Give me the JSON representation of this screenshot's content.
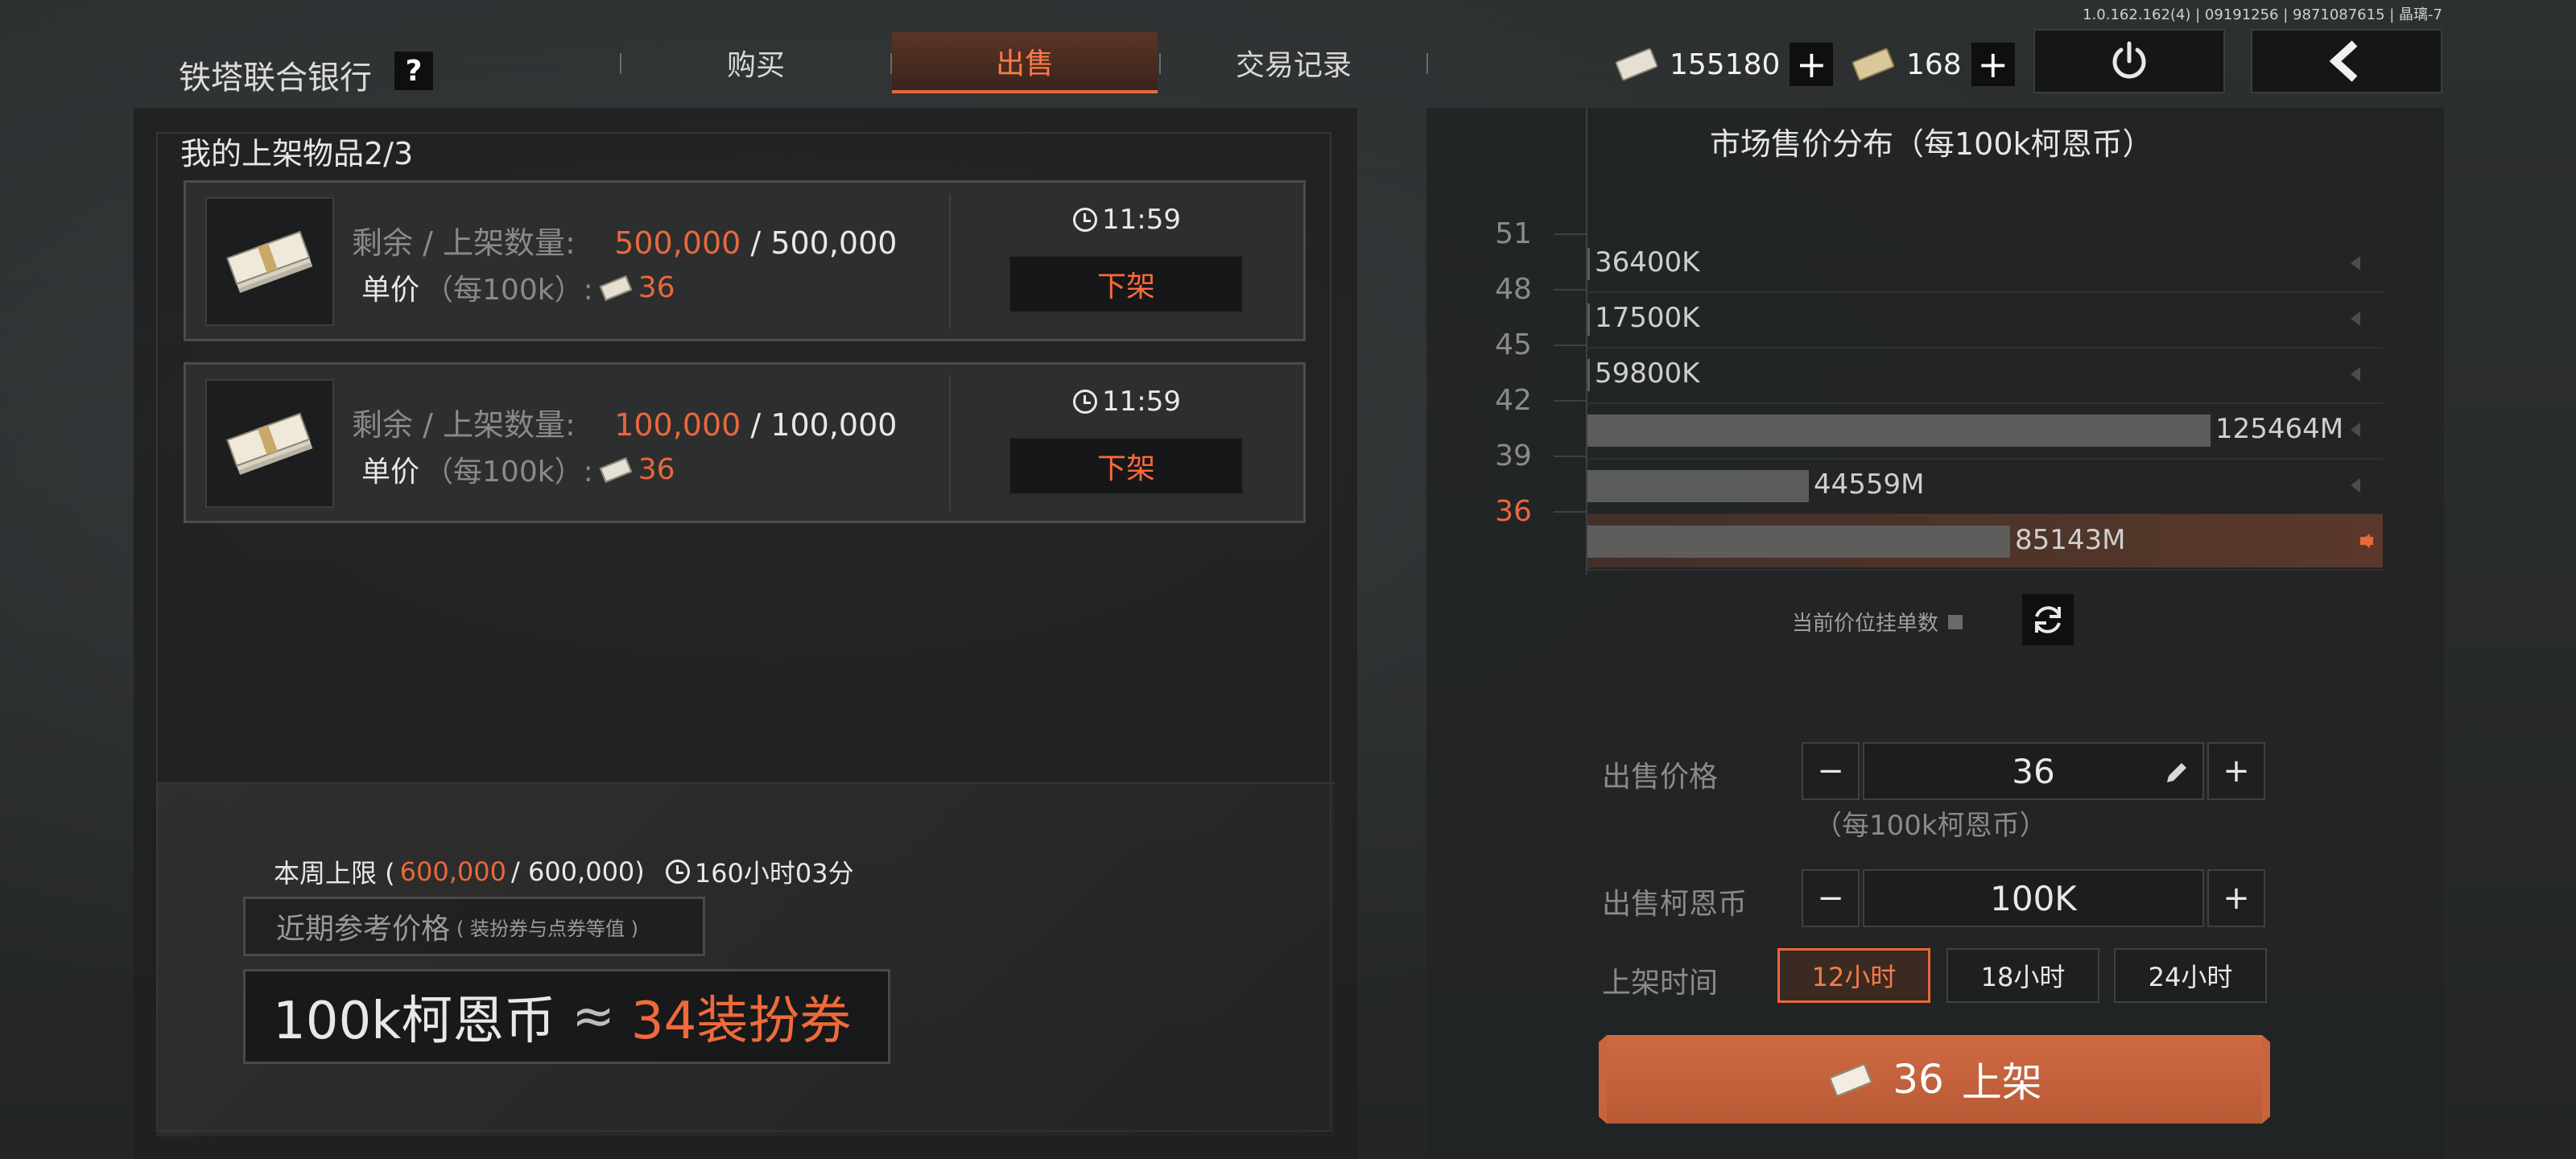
{
  "header": {
    "bank_title": "铁塔联合银行",
    "help_label": "?",
    "version": "1.0.162.162(4) | 09191256 | 9871087615 | 晶璃-7",
    "tabs": [
      {
        "label": "购买"
      },
      {
        "label": "出售",
        "active": true
      },
      {
        "label": "交易记录"
      }
    ],
    "currencies": [
      {
        "icon": "cash-icon",
        "value": "155180",
        "plus": "+"
      },
      {
        "icon": "coupon-icon",
        "value": "168",
        "plus": "+"
      }
    ],
    "accent_color": "#e8683c"
  },
  "listings": {
    "title": "我的上架物品2/3",
    "labels": {
      "remaining": "剩余",
      "slash": "/",
      "listed_qty": "上架数量:",
      "unit_price": "单价",
      "per": "（每100k）:",
      "delist": "下架"
    },
    "items": [
      {
        "remaining": "500,000",
        "total": "500,000",
        "price": "36",
        "time": "11:59"
      },
      {
        "remaining": "100,000",
        "total": "100,000",
        "price": "36",
        "time": "11:59"
      }
    ]
  },
  "weekly": {
    "prefix": "本周上限 (",
    "used": "600,000",
    "limit": "/ 600,000)",
    "time": "160小时03分"
  },
  "reference": {
    "label": "近期参考价格",
    "sub": "( 装扮券与点券等值 )",
    "left": "100k柯恩币",
    "approx": "≈",
    "right": "34装扮券"
  },
  "chart_data": {
    "type": "bar",
    "title": "市场售价分布（每100k柯恩币）",
    "categories": [
      "51",
      "48",
      "45",
      "42",
      "39",
      "36"
    ],
    "values": [
      36.4,
      17.5,
      59.8,
      125464,
      44559,
      85143
    ],
    "value_labels": [
      "36400K",
      "17500K",
      "59800K",
      "125464M",
      "44559M",
      "85143M"
    ],
    "current_price": "36",
    "legend": "当前价位挂单数"
  },
  "sell_form": {
    "price_label": "出售价格",
    "price_value": "36",
    "price_unit": "（每100k柯恩币）",
    "amount_label": "出售柯恩币",
    "amount_value": "100K",
    "minus": "−",
    "plus": "+",
    "duration_label": "上架时间",
    "durations": [
      "12小时",
      "18小时",
      "24小时"
    ],
    "selected_duration": "12小时",
    "submit_price": "36",
    "submit_label": "上架"
  }
}
